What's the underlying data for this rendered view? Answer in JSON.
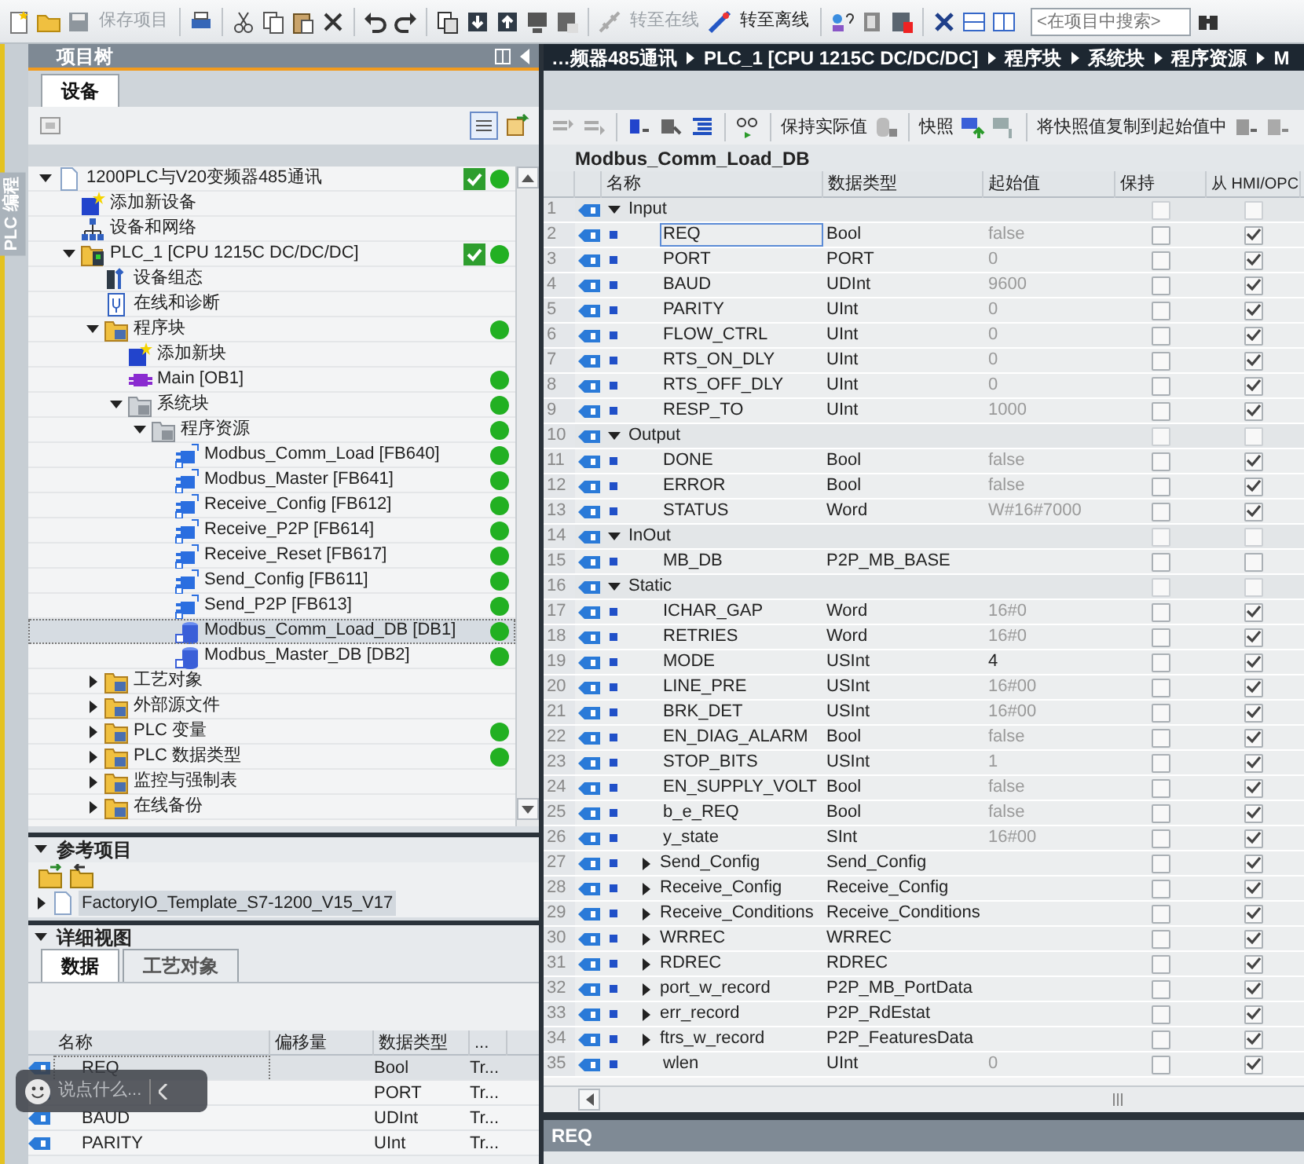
{
  "toolbar": {
    "save": {
      "label": "保存项目",
      "disabled": true
    },
    "go_online": {
      "label": "转至在线",
      "disabled": true
    },
    "go_offline": {
      "label": "转至离线",
      "disabled": false
    },
    "search": {
      "placeholder": "<在项目中搜索>"
    }
  },
  "side_tab": {
    "label": "PLC 编程"
  },
  "project_tree": {
    "title": "项目树",
    "tabs": [
      {
        "label": "设备",
        "selected": true
      }
    ],
    "items": [
      {
        "label": "1200PLC与V20变频器485通讯",
        "kind": "project",
        "expanded": true,
        "selected": false,
        "compiled": true,
        "online": true,
        "children": [
          {
            "label": "添加新设备",
            "kind": "add",
            "selected": false,
            "compiled": false,
            "online": false
          },
          {
            "label": "设备和网络",
            "kind": "network",
            "selected": false,
            "compiled": false,
            "online": false
          },
          {
            "label": "PLC_1 [CPU 1215C DC/DC/DC]",
            "kind": "plc",
            "expanded": true,
            "selected": false,
            "compiled": true,
            "online": true,
            "children": [
              {
                "label": "设备组态",
                "kind": "config",
                "selected": false,
                "compiled": false,
                "online": false
              },
              {
                "label": "在线和诊断",
                "kind": "diagnostics",
                "selected": false,
                "compiled": false,
                "online": false
              },
              {
                "label": "程序块",
                "kind": "folder",
                "expanded": true,
                "selected": false,
                "compiled": false,
                "online": true,
                "children": [
                  {
                    "label": "添加新块",
                    "kind": "add",
                    "selected": false,
                    "compiled": false,
                    "online": false
                  },
                  {
                    "label": "Main [OB1]",
                    "kind": "ob",
                    "selected": false,
                    "compiled": false,
                    "online": true
                  },
                  {
                    "label": "系统块",
                    "kind": "grey_folder",
                    "expanded": true,
                    "selected": false,
                    "compiled": false,
                    "online": true,
                    "children": [
                      {
                        "label": "程序资源",
                        "kind": "grey_folder",
                        "expanded": true,
                        "selected": false,
                        "compiled": false,
                        "online": true,
                        "children": [
                          {
                            "label": "Modbus_Comm_Load [FB640]",
                            "kind": "fb",
                            "selected": false,
                            "compiled": false,
                            "online": true
                          },
                          {
                            "label": "Modbus_Master [FB641]",
                            "kind": "fb",
                            "selected": false,
                            "compiled": false,
                            "online": true
                          },
                          {
                            "label": "Receive_Config [FB612]",
                            "kind": "fb",
                            "selected": false,
                            "compiled": false,
                            "online": true
                          },
                          {
                            "label": "Receive_P2P [FB614]",
                            "kind": "fb",
                            "selected": false,
                            "compiled": false,
                            "online": true
                          },
                          {
                            "label": "Receive_Reset [FB617]",
                            "kind": "fb",
                            "selected": false,
                            "compiled": false,
                            "online": true
                          },
                          {
                            "label": "Send_Config [FB611]",
                            "kind": "fb",
                            "selected": false,
                            "compiled": false,
                            "online": true
                          },
                          {
                            "label": "Send_P2P [FB613]",
                            "kind": "fb",
                            "selected": false,
                            "compiled": false,
                            "online": true
                          },
                          {
                            "label": "Modbus_Comm_Load_DB [DB1]",
                            "kind": "db",
                            "selected": true,
                            "compiled": false,
                            "online": true
                          },
                          {
                            "label": "Modbus_Master_DB [DB2]",
                            "kind": "db",
                            "selected": false,
                            "compiled": false,
                            "online": true
                          }
                        ]
                      }
                    ]
                  }
                ]
              },
              {
                "label": "工艺对象",
                "kind": "folder",
                "expanded": false,
                "selected": false,
                "compiled": false,
                "online": false
              },
              {
                "label": "外部源文件",
                "kind": "folder",
                "expanded": false,
                "selected": false,
                "compiled": false,
                "online": false
              },
              {
                "label": "PLC 变量",
                "kind": "folder",
                "expanded": false,
                "selected": false,
                "compiled": false,
                "online": true
              },
              {
                "label": "PLC 数据类型",
                "kind": "folder",
                "expanded": false,
                "selected": false,
                "compiled": false,
                "online": true
              },
              {
                "label": "监控与强制表",
                "kind": "folder",
                "expanded": false,
                "selected": false,
                "compiled": false,
                "online": false
              },
              {
                "label": "在线备份",
                "kind": "folder",
                "expanded": false,
                "selected": false,
                "compiled": false,
                "online": false
              }
            ]
          }
        ]
      }
    ]
  },
  "reference_projects": {
    "title": "参考项目",
    "expanded": true,
    "items": [
      {
        "label": "FactoryIO_Template_S7-1200_V15_V17",
        "expanded": false,
        "selected": true
      }
    ]
  },
  "detail_view": {
    "title": "详细视图",
    "expanded": true,
    "tabs": [
      {
        "label": "数据",
        "selected": true
      },
      {
        "label": "工艺对象",
        "selected": false
      }
    ],
    "columns": [
      "名称",
      "偏移量",
      "数据类型",
      "..."
    ],
    "rows": [
      {
        "name": "REQ",
        "type": "Bool",
        "column_4": "Tr...",
        "selected": true
      },
      {
        "type": "PORT",
        "column_4": "Tr...",
        "selected": false
      },
      {
        "name": "BAUD",
        "type": "UDInt",
        "column_4": "Tr...",
        "selected": false
      },
      {
        "name": "PARITY",
        "type": "UInt",
        "column_4": "Tr...",
        "selected": false
      }
    ]
  },
  "editor": {
    "breadcrumb": [
      "…频器485通讯",
      "PLC_1 [CPU 1215C DC/DC/DC]",
      "程序块",
      "系统块",
      "程序资源",
      "M"
    ],
    "toolbar": [
      "保持实际值",
      "快照",
      "将快照值复制到起始值中"
    ],
    "block_title": "Modbus_Comm_Load_DB",
    "columns": [
      "名称",
      "数据类型",
      "起始值",
      "保持",
      "从 HMI/OPC"
    ],
    "rows": [
      {
        "number": "1",
        "kind": "section",
        "expanded": true,
        "name": "Input",
        "retain": false,
        "hmi": false,
        "selected": false
      },
      {
        "number": "2",
        "kind": "member",
        "name": "REQ",
        "type": "Bool",
        "start": "false",
        "start_default": true,
        "retain": false,
        "hmi": true,
        "selected": true
      },
      {
        "number": "3",
        "kind": "member",
        "name": "PORT",
        "type": "PORT",
        "start": "0",
        "start_default": true,
        "retain": false,
        "hmi": true,
        "selected": false
      },
      {
        "number": "4",
        "kind": "member",
        "name": "BAUD",
        "type": "UDInt",
        "start": "9600",
        "start_default": true,
        "retain": false,
        "hmi": true,
        "selected": false
      },
      {
        "number": "5",
        "kind": "member",
        "name": "PARITY",
        "type": "UInt",
        "start": "0",
        "start_default": true,
        "retain": false,
        "hmi": true,
        "selected": false
      },
      {
        "number": "6",
        "kind": "member",
        "name": "FLOW_CTRL",
        "type": "UInt",
        "start": "0",
        "start_default": true,
        "retain": false,
        "hmi": true,
        "selected": false
      },
      {
        "number": "7",
        "kind": "member",
        "name": "RTS_ON_DLY",
        "type": "UInt",
        "start": "0",
        "start_default": true,
        "retain": false,
        "hmi": true,
        "selected": false
      },
      {
        "number": "8",
        "kind": "member",
        "name": "RTS_OFF_DLY",
        "type": "UInt",
        "start": "0",
        "start_default": true,
        "retain": false,
        "hmi": true,
        "selected": false
      },
      {
        "number": "9",
        "kind": "member",
        "name": "RESP_TO",
        "type": "UInt",
        "start": "1000",
        "start_default": true,
        "retain": false,
        "hmi": true,
        "selected": false
      },
      {
        "number": "10",
        "kind": "section",
        "expanded": true,
        "name": "Output",
        "retain": false,
        "hmi": false,
        "selected": false
      },
      {
        "number": "11",
        "kind": "member",
        "name": "DONE",
        "type": "Bool",
        "start": "false",
        "start_default": true,
        "retain": false,
        "hmi": true,
        "selected": false
      },
      {
        "number": "12",
        "kind": "member",
        "name": "ERROR",
        "type": "Bool",
        "start": "false",
        "start_default": true,
        "retain": false,
        "hmi": true,
        "selected": false
      },
      {
        "number": "13",
        "kind": "member",
        "name": "STATUS",
        "type": "Word",
        "start": "W#16#7000",
        "start_default": true,
        "retain": false,
        "hmi": true,
        "selected": false
      },
      {
        "number": "14",
        "kind": "section",
        "expanded": true,
        "name": "InOut",
        "retain": false,
        "hmi": false,
        "selected": false
      },
      {
        "number": "15",
        "kind": "member",
        "name": "MB_DB",
        "type": "P2P_MB_BASE",
        "retain": false,
        "hmi": false,
        "selected": false
      },
      {
        "number": "16",
        "kind": "section",
        "expanded": true,
        "name": "Static",
        "retain": false,
        "hmi": false,
        "selected": false
      },
      {
        "number": "17",
        "kind": "member",
        "name": "ICHAR_GAP",
        "type": "Word",
        "start": "16#0",
        "start_default": true,
        "retain": false,
        "hmi": true,
        "selected": false
      },
      {
        "number": "18",
        "kind": "member",
        "name": "RETRIES",
        "type": "Word",
        "start": "16#0",
        "start_default": true,
        "retain": false,
        "hmi": true,
        "selected": false
      },
      {
        "number": "19",
        "kind": "member",
        "name": "MODE",
        "type": "USInt",
        "start": "4",
        "start_default": false,
        "retain": false,
        "hmi": true,
        "selected": false
      },
      {
        "number": "20",
        "kind": "member",
        "name": "LINE_PRE",
        "type": "USInt",
        "start": "16#00",
        "start_default": true,
        "retain": false,
        "hmi": true,
        "selected": false
      },
      {
        "number": "21",
        "kind": "member",
        "name": "BRK_DET",
        "type": "USInt",
        "start": "16#00",
        "start_default": true,
        "retain": false,
        "hmi": true,
        "selected": false
      },
      {
        "number": "22",
        "kind": "member",
        "name": "EN_DIAG_ALARM",
        "type": "Bool",
        "start": "false",
        "start_default": true,
        "retain": false,
        "hmi": true,
        "selected": false
      },
      {
        "number": "23",
        "kind": "member",
        "name": "STOP_BITS",
        "type": "USInt",
        "start": "1",
        "start_default": true,
        "retain": false,
        "hmi": true,
        "selected": false
      },
      {
        "number": "24",
        "kind": "member",
        "name": "EN_SUPPLY_VOLT",
        "type": "Bool",
        "start": "false",
        "start_default": true,
        "retain": false,
        "hmi": true,
        "selected": false
      },
      {
        "number": "25",
        "kind": "member",
        "name": "b_e_REQ",
        "type": "Bool",
        "start": "false",
        "start_default": true,
        "retain": false,
        "hmi": true,
        "selected": false
      },
      {
        "number": "26",
        "kind": "member",
        "name": "y_state",
        "type": "SInt",
        "start": "16#00",
        "start_default": true,
        "retain": false,
        "hmi": true,
        "selected": false
      },
      {
        "number": "27",
        "kind": "struct",
        "expanded": false,
        "name": "Send_Config",
        "type": "Send_Config",
        "retain": false,
        "hmi": true,
        "selected": false
      },
      {
        "number": "28",
        "kind": "struct",
        "expanded": false,
        "name": "Receive_Config",
        "type": "Receive_Config",
        "retain": false,
        "hmi": true,
        "selected": false
      },
      {
        "number": "29",
        "kind": "struct",
        "expanded": false,
        "name": "Receive_Conditions",
        "type": "Receive_Conditions",
        "retain": false,
        "hmi": true,
        "selected": false
      },
      {
        "number": "30",
        "kind": "struct",
        "expanded": false,
        "name": "WRREC",
        "type": "WRREC",
        "retain": false,
        "hmi": true,
        "selected": false
      },
      {
        "number": "31",
        "kind": "struct",
        "expanded": false,
        "name": "RDREC",
        "type": "RDREC",
        "retain": false,
        "hmi": true,
        "selected": false
      },
      {
        "number": "32",
        "kind": "struct",
        "expanded": false,
        "name": "port_w_record",
        "type": "P2P_MB_PortData",
        "retain": false,
        "hmi": true,
        "selected": false
      },
      {
        "number": "33",
        "kind": "struct",
        "expanded": false,
        "name": "err_record",
        "type": "P2P_RdEstat",
        "retain": false,
        "hmi": true,
        "selected": false
      },
      {
        "number": "34",
        "kind": "struct",
        "expanded": false,
        "name": "ftrs_w_record",
        "type": "P2P_FeaturesData",
        "retain": false,
        "hmi": true,
        "selected": false
      },
      {
        "number": "35",
        "kind": "member",
        "name": "wlen",
        "type": "UInt",
        "start": "0",
        "start_default": true,
        "retain": false,
        "hmi": true,
        "selected": false
      }
    ]
  },
  "properties_bar": {
    "title": "REQ"
  },
  "chat_widget": {
    "placeholder": "说点什么..."
  }
}
